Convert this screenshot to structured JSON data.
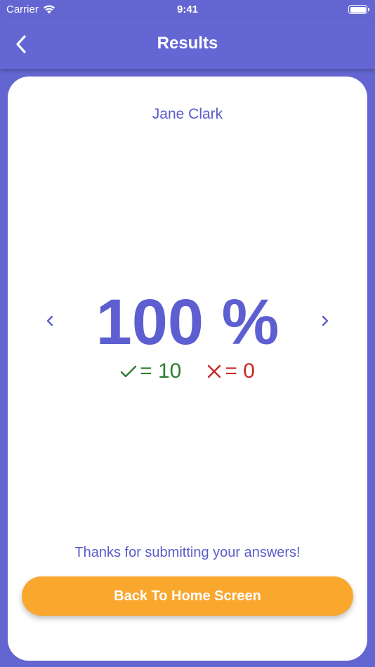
{
  "status_bar": {
    "carrier": "Carrier",
    "time": "9:41",
    "wifi_icon": "wifi-icon",
    "battery_icon": "battery-icon",
    "battery_level": 1.0
  },
  "nav": {
    "title": "Results",
    "back_icon": "chevron-left-icon"
  },
  "result": {
    "student_name": "Jane Clark",
    "score": "100 %",
    "correct_count": "= 10",
    "wrong_count": "= 0",
    "correct_icon": "check-icon",
    "wrong_icon": "cross-icon",
    "thanks_message": "Thanks for submitting your answers!",
    "home_button_label": "Back To Home Screen"
  },
  "colors": {
    "background": "#6366d1",
    "accent": "#5d5fd0",
    "correct": "#2e7d32",
    "wrong": "#c62828",
    "button": "#f9a72d"
  }
}
